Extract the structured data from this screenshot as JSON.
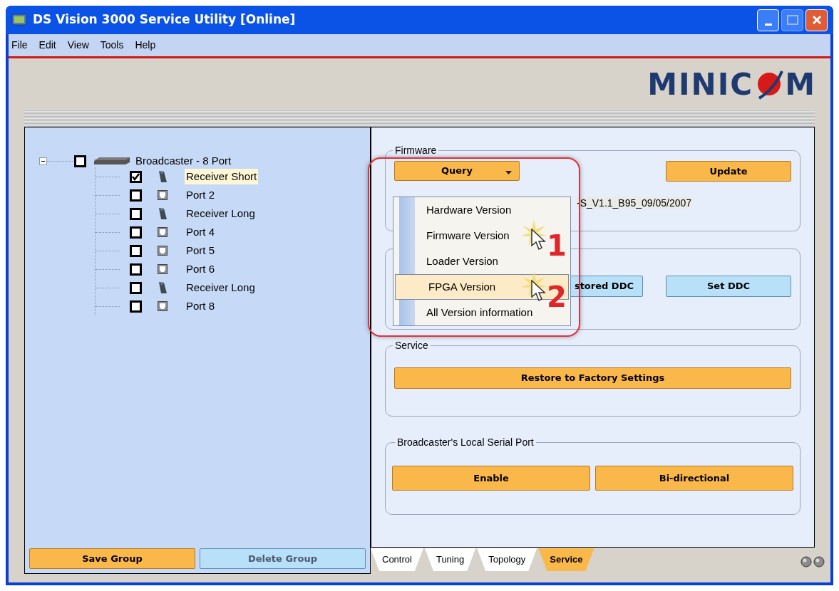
{
  "window": {
    "title": "DS Vision 3000 Service Utility [Online]"
  },
  "menu_bar": [
    "File",
    "Edit",
    "View",
    "Tools",
    "Help"
  ],
  "logo": {
    "before": "MINIC",
    "after": "M"
  },
  "tree": [
    {
      "label": "Broadcaster - 8  Port",
      "kind": "broadcaster",
      "checked": false,
      "selected": false,
      "expanded": true,
      "children": [
        {
          "label": "Receiver Short",
          "kind": "receiver",
          "checked": true,
          "selected": true
        },
        {
          "label": "Port 2",
          "kind": "port",
          "checked": false,
          "selected": false
        },
        {
          "label": "Receiver Long",
          "kind": "receiver",
          "checked": false,
          "selected": false
        },
        {
          "label": "Port 4",
          "kind": "port",
          "checked": false,
          "selected": false
        },
        {
          "label": "Port 5",
          "kind": "port",
          "checked": false,
          "selected": false
        },
        {
          "label": "Port 6",
          "kind": "port",
          "checked": false,
          "selected": false
        },
        {
          "label": "Receiver Long",
          "kind": "receiver",
          "checked": false,
          "selected": false
        },
        {
          "label": "Port 8",
          "kind": "port",
          "checked": false,
          "selected": false
        }
      ]
    }
  ],
  "left_buttons": [
    {
      "label": "Save Group",
      "kind": "orange"
    },
    {
      "label": "Delete Group",
      "kind": "blue"
    }
  ],
  "firmware": {
    "title": "Firmware",
    "query_button": "Query",
    "update_button": "Update",
    "version_text": "-S_V1.1_B95_09/05/2007"
  },
  "ddc": {
    "buttons": [
      {
        "label": "stored DDC",
        "kind": "blue"
      },
      {
        "label": "Set DDC",
        "kind": "blue"
      }
    ]
  },
  "service": {
    "title": "Service",
    "button": "Restore to Factory Settings"
  },
  "serial_port": {
    "title": "Broadcaster's Local  Serial Port",
    "buttons": [
      {
        "label": "Enable",
        "kind": "orange"
      },
      {
        "label": "Bi-directional",
        "kind": "orange"
      }
    ]
  },
  "query_menu": [
    {
      "label": "Hardware Version",
      "selected": false
    },
    {
      "label": "Firmware Version",
      "selected": false
    },
    {
      "label": "Loader Version",
      "selected": false
    },
    {
      "label": "FPGA Version",
      "selected": true
    },
    {
      "label": "All Version information",
      "selected": false
    }
  ],
  "annotations": [
    {
      "number": "1"
    },
    {
      "number": "2"
    }
  ],
  "tabs": [
    {
      "label": "Control",
      "selected": false
    },
    {
      "label": "Tuning",
      "selected": false
    },
    {
      "label": "Topology",
      "selected": false
    },
    {
      "label": "Service",
      "selected": true
    }
  ]
}
